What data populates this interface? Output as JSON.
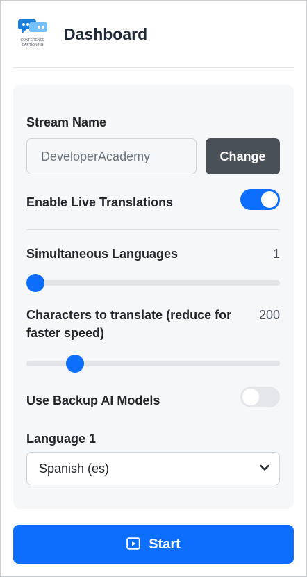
{
  "header": {
    "title": "Dashboard",
    "logo_icon": "speech-bubbles-logo-icon",
    "logo_text_line1": "CONFERENCE",
    "logo_text_line2": "CAPTIONING"
  },
  "stream": {
    "label": "Stream Name",
    "value": "DeveloperAcademy",
    "change_label": "Change"
  },
  "live_translations": {
    "label": "Enable Live Translations",
    "enabled": true
  },
  "simultaneous_languages": {
    "label": "Simultaneous Languages",
    "value": "1"
  },
  "characters": {
    "label": "Characters to translate (reduce for faster speed)",
    "value": "200"
  },
  "backup_ai": {
    "label": "Use Backup AI Models",
    "enabled": false
  },
  "language1": {
    "label": "Language 1",
    "selected": "Spanish (es)"
  },
  "start": {
    "label": "Start",
    "icon": "play-square-icon"
  },
  "colors": {
    "accent": "#0d6efd",
    "secondary_button": "#495057",
    "card_bg": "#f6f7f8"
  }
}
